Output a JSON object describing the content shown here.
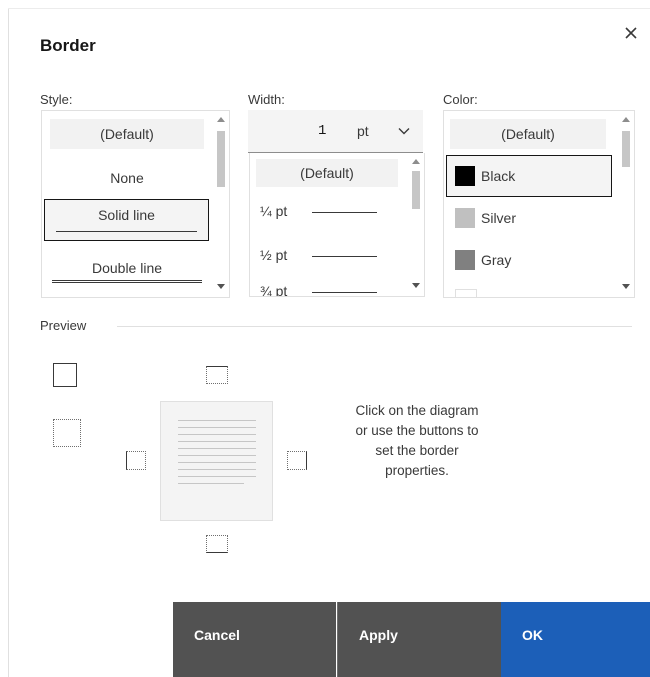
{
  "dialog": {
    "title": "Border",
    "close_icon": "close-icon"
  },
  "style": {
    "label": "Style:",
    "options": [
      "(Default)",
      "None",
      "Solid line",
      "Double line"
    ],
    "selected": "Solid line"
  },
  "width": {
    "label": "Width:",
    "value": "1",
    "unit": "pt",
    "options": [
      "(Default)",
      "¼ pt",
      "½ pt",
      "¾ pt"
    ]
  },
  "color": {
    "label": "Color:",
    "options": [
      {
        "name": "(Default)"
      },
      {
        "name": "Black",
        "hex": "#000000"
      },
      {
        "name": "Silver",
        "hex": "#c0c0c0"
      },
      {
        "name": "Gray",
        "hex": "#808080"
      }
    ],
    "selected": "Black"
  },
  "preview": {
    "label": "Preview",
    "hint": "Click on the diagram or use the buttons to set the border properties."
  },
  "footer": {
    "cancel": "Cancel",
    "apply": "Apply",
    "ok": "OK"
  },
  "colors": {
    "accent": "#1c5fb8",
    "secondary_button": "#525252"
  }
}
